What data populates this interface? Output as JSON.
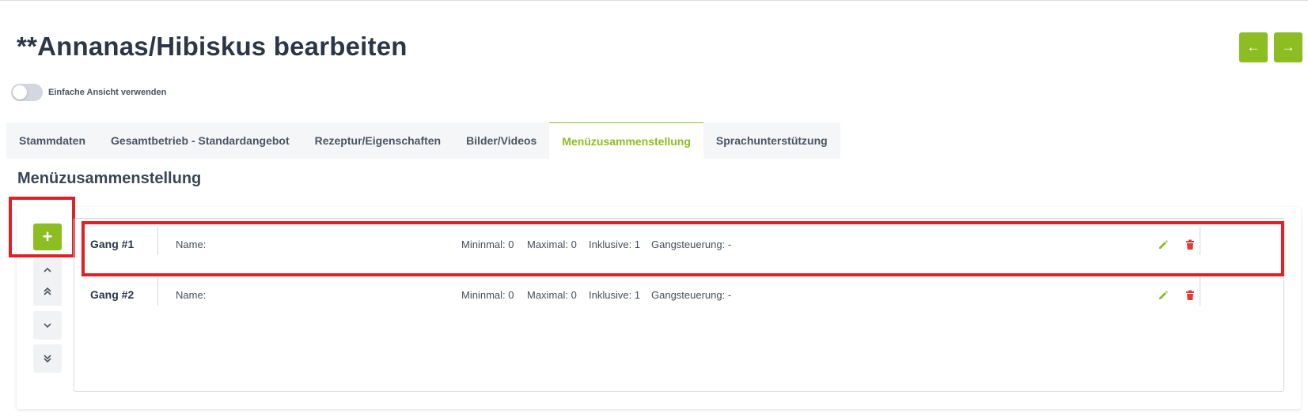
{
  "page": {
    "title": "**Annanas/Hibiskus bearbeiten"
  },
  "nav": {
    "prev_icon": "arrow-left-icon",
    "prev_glyph": "←",
    "next_icon": "arrow-right-icon",
    "next_glyph": "→"
  },
  "toggle": {
    "label": "Einfache Ansicht verwenden",
    "checked": false
  },
  "tabs": [
    {
      "label": "Stammdaten",
      "active": false
    },
    {
      "label": "Gesamtbetrieb - Standardangebot",
      "active": false
    },
    {
      "label": "Rezeptur/Eigenschaften",
      "active": false
    },
    {
      "label": "Bilder/Videos",
      "active": false
    },
    {
      "label": "Menüzusammenstellung",
      "active": true
    },
    {
      "label": "Sprachunterstützung",
      "active": false
    }
  ],
  "section": {
    "title": "Menüzusammenstellung"
  },
  "controls": {
    "add_glyph": "+",
    "up_glyph": "⌃",
    "top_glyph": "⌃⌃",
    "down_glyph": "⌄",
    "bottom_glyph": "⌄⌄"
  },
  "courses": [
    {
      "name": "Gang #1",
      "name_label": "Name:",
      "minimal": "Mininmal: 0",
      "maximal": "Maximal: 0",
      "inklusive": "Inklusive: 1",
      "gangsteuerung": "Gangsteuerung: -"
    },
    {
      "name": "Gang #2",
      "name_label": "Name:",
      "minimal": "Mininmal: 0",
      "maximal": "Maximal: 0",
      "inklusive": "Inklusive: 1",
      "gangsteuerung": "Gangsteuerung: -"
    }
  ],
  "colors": {
    "accent": "#8cbd23",
    "danger": "#e53935",
    "highlight": "#e01f26"
  }
}
